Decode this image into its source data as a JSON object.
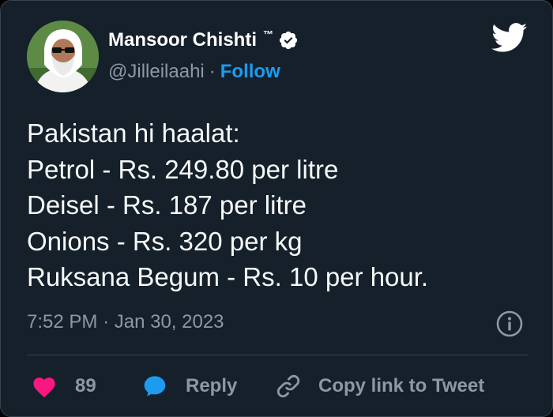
{
  "author": {
    "name": "Mansoor Chishti",
    "tm": "™",
    "handle": "@Jilleilaahi",
    "separator": "·",
    "follow_label": "Follow"
  },
  "tweet": {
    "lines": [
      "Pakistan hi haalat:",
      "Petrol - Rs. 249.80 per litre",
      "Deisel - Rs. 187 per litre",
      "Onions - Rs. 320 per kg",
      "Ruksana Begum - Rs. 10 per hour."
    ]
  },
  "meta": {
    "time": "7:52 PM",
    "separator": "·",
    "date": "Jan 30, 2023"
  },
  "actions": {
    "like_count": "89",
    "reply_label": "Reply",
    "copy_link_label": "Copy link to Tweet"
  },
  "colors": {
    "background": "#15202b",
    "accent": "#1d9bf0",
    "like": "#f91880",
    "muted_text": "#8b98a5",
    "text": "#f7f9f9"
  },
  "icons": {
    "logo": "twitter-bird-icon",
    "verified": "verified-badge-icon",
    "info": "info-icon",
    "like": "heart-icon",
    "reply": "speech-bubble-icon",
    "copy_link": "link-icon"
  }
}
